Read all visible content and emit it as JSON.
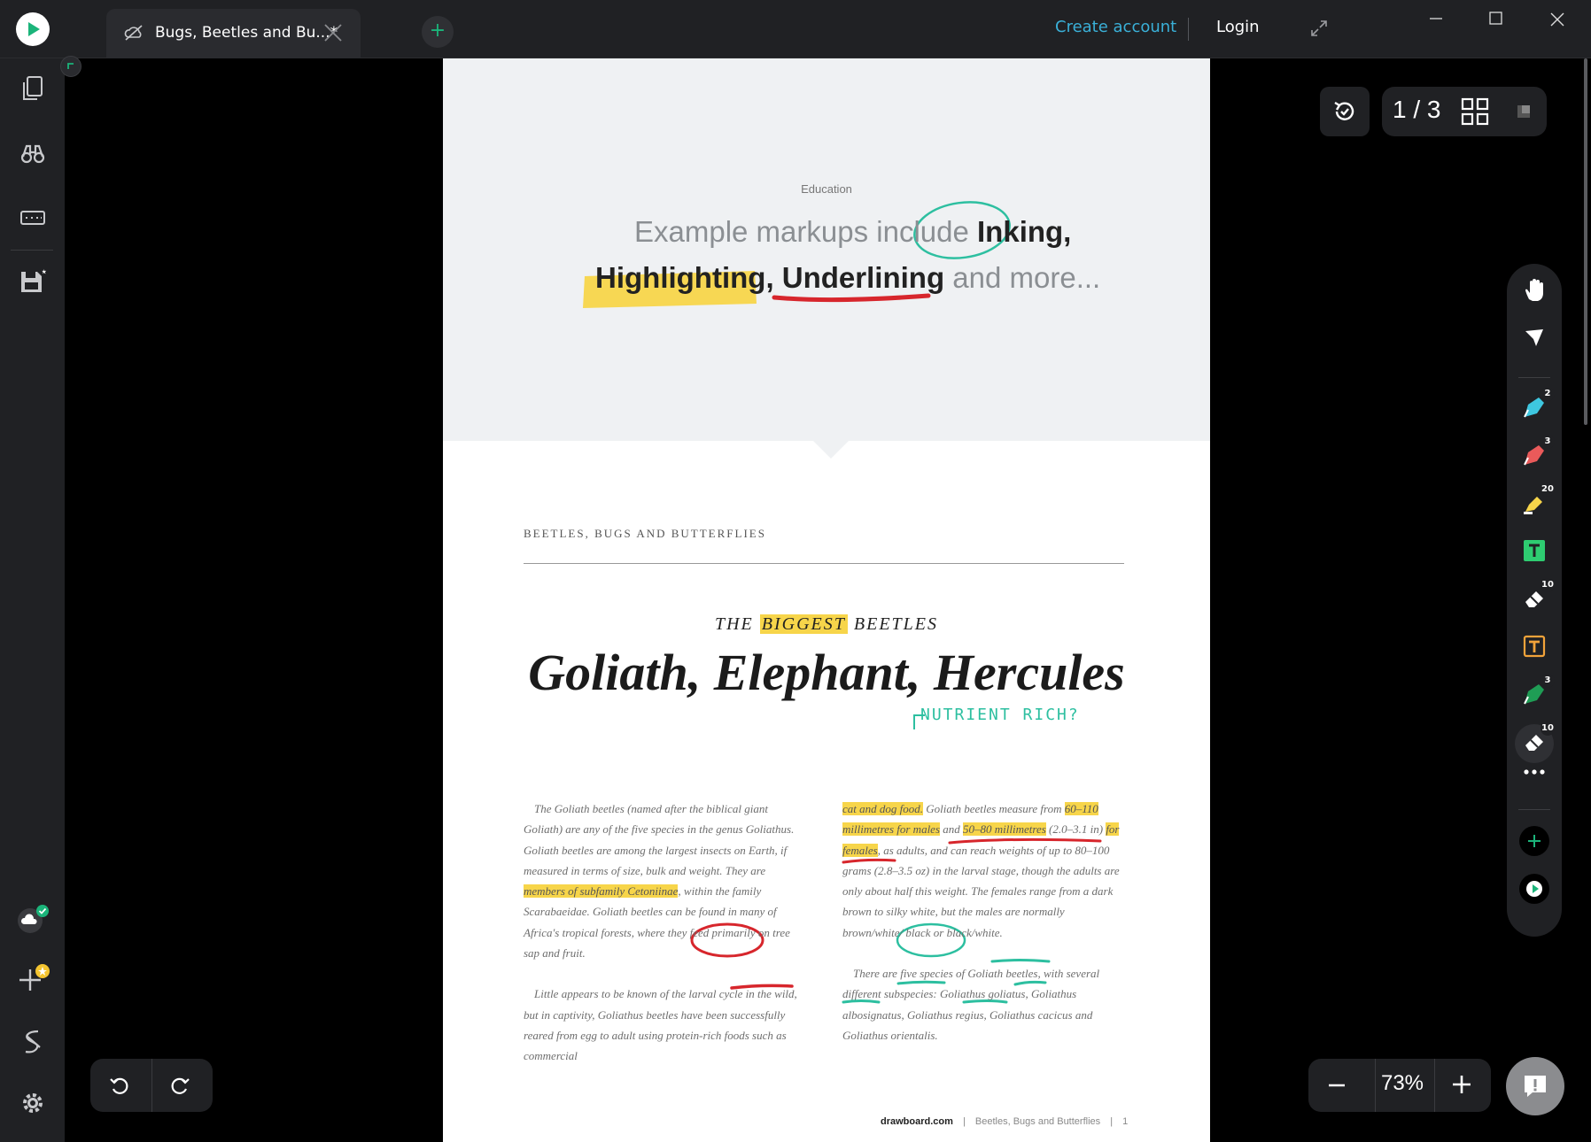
{
  "titlebar": {
    "tab_title": "Bugs, Beetles and Bu...*",
    "new_tab": "+",
    "create_account": "Create account",
    "login": "Login"
  },
  "document": {
    "category": "Education",
    "hero_line1_prefix": "Example markups include ",
    "hero_word_inking": "Inking,",
    "hero_word_highlighting": "Highlighting,",
    "hero_word_underlining": "Underlining",
    "hero_line2_suffix": " and more...",
    "running_head": "BEETLES, BUGS AND BUTTERFLIES",
    "kicker_pre": "THE ",
    "kicker_mark": "BIGGEST",
    "kicker_post": " BEETLES",
    "headline": "Goliath, Elephant, Hercules",
    "handwritten_note": "NUTRIENT RICH?",
    "left_p1_a": "The Goliath beetles (named after the biblical giant Goliath) are any of the five species in the genus Goliathus. Goliath beetles are among the largest insects on Earth, if measured in terms of size, bulk and weight. They are ",
    "left_p1_hl": "members of subfamily Cetoniinae",
    "left_p1_b": ", within the family Scarabaeidae. Goliath beetles can be found in many of Africa's tropical forests, where they feed primarily on tree sap and fruit.",
    "left_p2_a": "Little appears to be known of the ",
    "left_p2_circle": "larval cycle",
    "left_p2_b": " in the wild, but in captivity, Goliathus beetles have been successfully reared from egg to adult using ",
    "left_p2_ul": "protein-rich",
    "left_p2_c": " foods such as commercial",
    "right_p1_hl1": "cat and dog food.",
    "right_p1_a": " Goliath beetles measure from ",
    "right_p1_hl2": "60–110 millimetres for males",
    "right_p1_b": " and ",
    "right_p1_hl3": "50–80 millimetres",
    "right_p1_c": " (2.0–3.1 in) ",
    "right_p1_hl4": "for females",
    "right_p1_d": ", as adults, and can reach weights of up to 80–100 grams (2.8–3.5 oz) in the larval stage, though the adults are only about half this weight. The females range from a dark brown to silky white, but the males are normally brown/white/ black or black/white.",
    "right_p2_a": "There are ",
    "right_p2_circle": "five species",
    "right_p2_b": " of Goliath beetles, with several different subspecies: Goliathus ",
    "right_p2_s1": "goliatus",
    "right_p2_c": ", Goliathus ",
    "right_p2_s2": "albosignatus",
    "right_p2_d": ", Goliathus ",
    "right_p2_s3": "regius",
    "right_p2_e": ", Goliathus ",
    "right_p2_s4": "cacicus",
    "right_p2_f": " and Goliathus ",
    "right_p2_s5": "orientalis",
    "right_p2_g": ".",
    "footer_site": "drawboard.com",
    "footer_title": "Beetles, Bugs and Butterflies",
    "footer_page": "1"
  },
  "pager": {
    "indicator": "1 / 3"
  },
  "toolbar": {
    "badges": {
      "pen_blue": "2",
      "pen_red": "3",
      "highlighter": "20",
      "eraser": "10",
      "pen_green": "3",
      "eraser_locked": "10"
    }
  },
  "zoom": {
    "minus": "−",
    "value": "73%",
    "plus": "+"
  },
  "colors": {
    "brand_green": "#1bb47a",
    "link_blue": "#3ab0d8",
    "highlight_yellow": "#f7d54a",
    "ink_red": "#d7262c",
    "ink_teal": "#2dbfa0"
  },
  "icons": [
    "app-logo-icon",
    "cloud-off-icon",
    "close-icon",
    "expand-icon",
    "pages-icon",
    "binoculars-icon",
    "keyboard-icon",
    "save-icon",
    "cloud-sync-icon",
    "add-feature-icon",
    "drawboard-s-icon",
    "settings-icon",
    "history-icon",
    "grid-icon",
    "hand-icon",
    "pointer-icon",
    "pen-icon",
    "highlighter-icon",
    "text-box-icon",
    "eraser-icon",
    "more-icon",
    "undo-icon",
    "redo-icon",
    "feedback-icon"
  ]
}
